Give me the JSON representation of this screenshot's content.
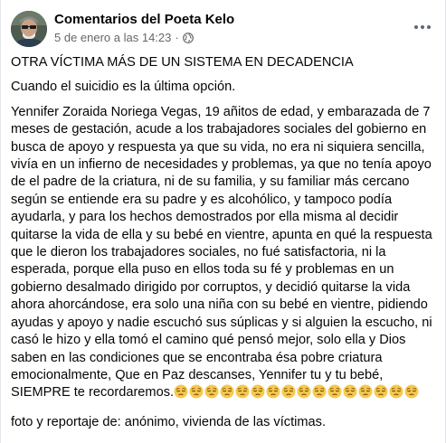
{
  "post": {
    "author": "Comentarios del Poeta Kelo",
    "date": "5 de enero a las 14:23",
    "separator": "·",
    "privacy_icon": "globe-icon",
    "more_icon": "more-options-icon",
    "headline": "OTRA VÍCTIMA MÁS DE UN SISTEMA EN DECADENCIA",
    "subheadline": "Cuando el suicidio es la última opción.",
    "body": "Yennifer Zoraida Noriega Vegas, 19 añitos de edad, y embarazada de 7 meses de gestación, acude a los trabajadores sociales del gobierno en busca de apoyo y respuesta ya que su vida, no era ni siquiera sencilla, vivía en un infierno de necesidades y problemas, ya que no tenía apoyo de el padre de la criatura, ni de su familia, y su familiar más cercano según se entiende era su padre y es alcohólico, y tampoco podía ayudarla, y para los hechos demostrados por ella misma al decidir quitarse la vida de ella y su bebé en vientre, apunta en qué la respuesta que le dieron los trabajadores sociales, no fué satisfactoria, ni la esperada, porque ella puso en ellos toda su fé y problemas en un gobierno desalmado dirigido por corruptos, y decidió quitarse la vida ahora ahorcándose, era solo una niña con su bebé en vientre, pidiendo ayudas y apoyo y nadie escuchó sus súplicas y si alguien la escucho, ni casó le hizo y ella tomó el camino qué pensó mejor, solo ella y Dios saben en las condiciones que se encontraba ésa pobre criatura emocionalmente, Que en Paz descanses, Yennifer tu y tu bebé, SIEMPRE te recordaremos.",
    "emoji_name": "pensive-face-emoji",
    "emoji_count": 16,
    "credit": "foto y reportaje de: anónimo, vivienda de las víctimas."
  },
  "colors": {
    "text_primary": "#050505",
    "text_secondary": "#65676b",
    "emoji_face": "#f7c84a"
  }
}
